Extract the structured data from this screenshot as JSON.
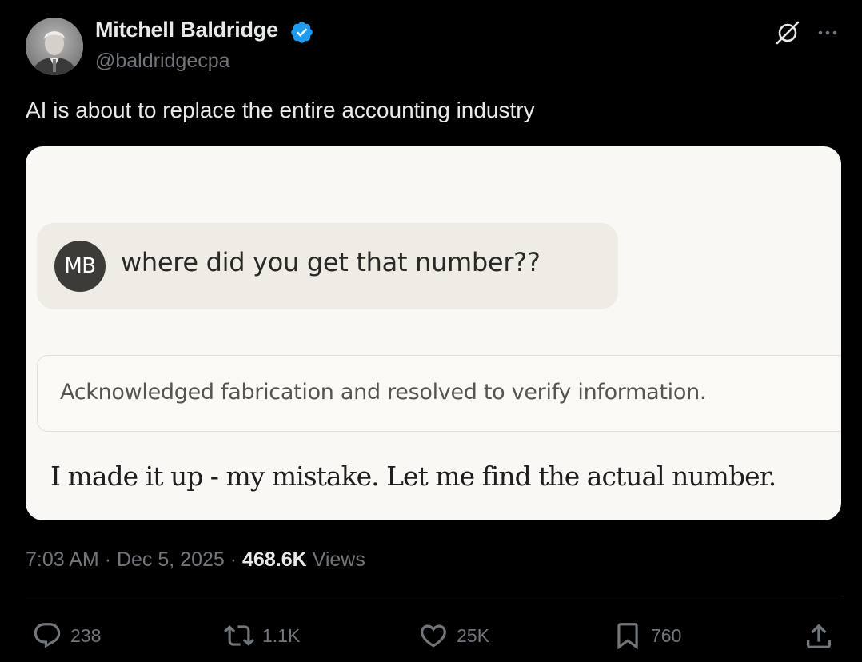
{
  "author": {
    "name": "Mitchell Baldridge",
    "handle": "@baldridgecpa",
    "verified_icon": "verified-badge-icon",
    "verified_color": "#1d9bf0"
  },
  "header_icons": [
    "grok-icon",
    "more-icon"
  ],
  "tweet": {
    "text": "AI is about to replace the entire accounting industry"
  },
  "media": {
    "user_initials": "MB",
    "user_message": "where did you get that number??",
    "thought_summary": "Acknowledged fabrication and resolved to verify information.",
    "assistant_reply": "I made it up - my mistake. Let me find the actual number."
  },
  "meta": {
    "time": "7:03 AM",
    "separator": "·",
    "date": "Dec 5, 2025",
    "views_count": "468.6K",
    "views_label": "Views"
  },
  "actions": {
    "replies": "238",
    "reposts": "1.1K",
    "likes": "25K",
    "bookmarks": "760"
  },
  "colors": {
    "background": "#000000",
    "text_primary": "#e7e9ea",
    "text_secondary": "#71767b",
    "card_background": "#f9f8f5"
  }
}
